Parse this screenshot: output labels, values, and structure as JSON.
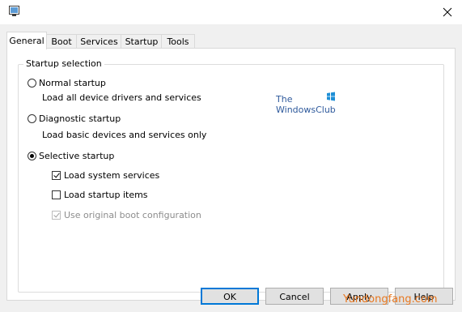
{
  "window": {
    "icon": "monitor-app-icon",
    "close_icon": "close-icon"
  },
  "tabs": [
    {
      "label": "General",
      "active": true
    },
    {
      "label": "Boot",
      "active": false
    },
    {
      "label": "Services",
      "active": false
    },
    {
      "label": "Startup",
      "active": false
    },
    {
      "label": "Tools",
      "active": false
    }
  ],
  "startup_selection": {
    "legend": "Startup selection",
    "normal": {
      "label": "Normal startup",
      "description": "Load all device drivers and services",
      "checked": false
    },
    "diagnostic": {
      "label": "Diagnostic startup",
      "description": "Load basic devices and services only",
      "checked": false
    },
    "selective": {
      "label": "Selective startup",
      "checked": true
    },
    "options": {
      "system_services": {
        "label": "Load system services",
        "checked": true
      },
      "startup_items": {
        "label": "Load startup items",
        "checked": false
      },
      "original_boot": {
        "label": "Use original boot configuration",
        "checked": true,
        "disabled": true
      }
    }
  },
  "watermark": {
    "line1": "The",
    "line2": "WindowsClub"
  },
  "buttons": {
    "ok": "OK",
    "cancel": "Cancel",
    "apply": "Apply",
    "help": "Help"
  },
  "footer_watermark": "Yundongfang.com",
  "colors": {
    "accent": "#0078d7",
    "watermark_blue": "#2f5a9c",
    "footer_orange": "#e87820"
  }
}
